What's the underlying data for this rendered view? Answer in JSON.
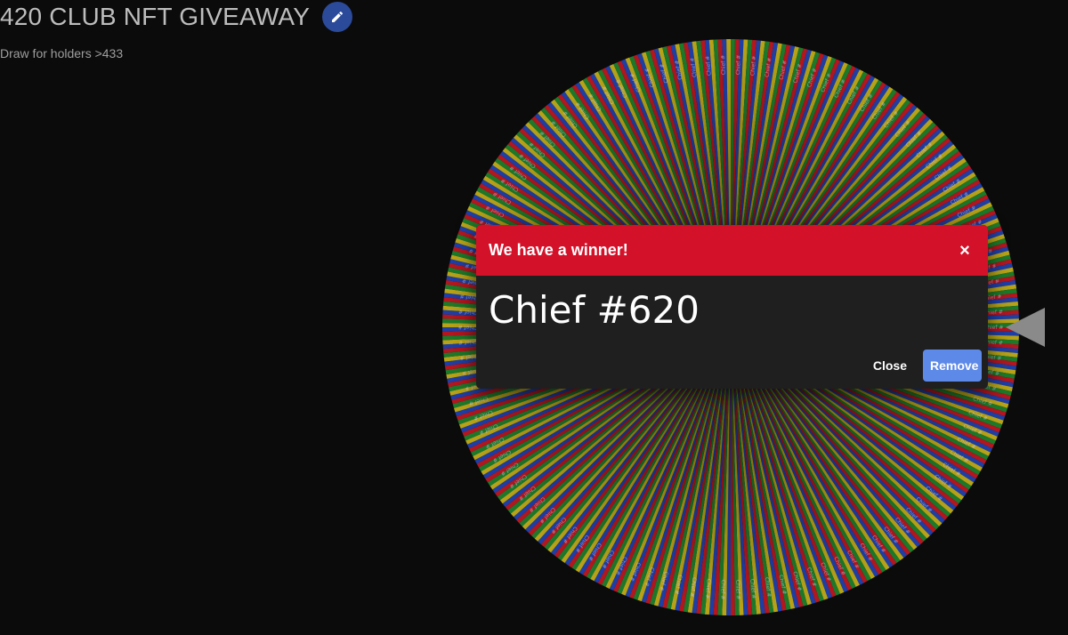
{
  "header": {
    "title": "420 CLUB NFT GIVEAWAY",
    "edit_icon": "pencil-icon",
    "edit_button_color": "#2b4a9a"
  },
  "subtitle": "Draw for holders >433",
  "wheel": {
    "entry_label": "Chief #",
    "segment_colors": [
      "#b5161f",
      "#1f3fa6",
      "#b8a318",
      "#1d7a2a"
    ],
    "segment_count": 420
  },
  "dialog": {
    "title": "We have a winner!",
    "close_x": "×",
    "winner": "Chief #620",
    "close_label": "Close",
    "remove_label": "Remove",
    "header_color": "#d3122a",
    "remove_color": "#5d8ae8"
  }
}
